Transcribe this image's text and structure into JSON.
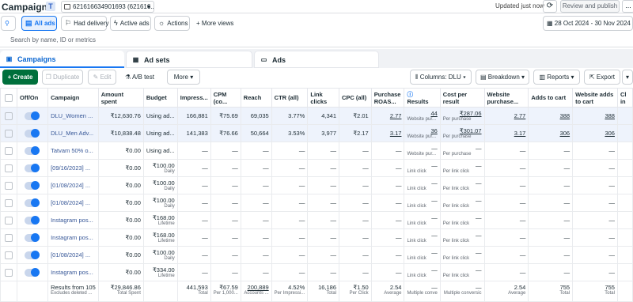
{
  "header": {
    "title": "Campaigns",
    "account_badge": "T",
    "account_label": "621616634901693 (621616...",
    "updated": "Updated just now",
    "review_label": "Review and publish",
    "more_label": "..."
  },
  "filters": {
    "all_ads": "All ads",
    "had_delivery": "Had delivery",
    "active_ads": "Active ads",
    "actions": "Actions",
    "more_views": "More views",
    "date_range": "28 Oct 2024 - 30 Nov 2024"
  },
  "search": {
    "placeholder": "Search by name, ID or metrics"
  },
  "tabs": {
    "campaigns": "Campaigns",
    "adsets": "Ad sets",
    "ads": "Ads"
  },
  "toolbar": {
    "create": "Create",
    "duplicate": "Duplicate",
    "edit": "Edit",
    "abtest": "A/B test",
    "more": "More",
    "columns": "Columns: DLU",
    "breakdown": "Breakdown",
    "reports": "Reports",
    "export": "Export"
  },
  "columns": {
    "onoff": "Off/On",
    "campaign": "Campaign",
    "amount": "Amount spent",
    "budget": "Budget",
    "impressions": "Impress...",
    "cpm": "CPM (co...",
    "reach": "Reach",
    "ctr": "CTR (all)",
    "link_clicks": "Link clicks",
    "cpc": "CPC (all)",
    "roas": "Purchase ROAS...",
    "results": "Results",
    "cost_per_result": "Cost per result",
    "website_purchase": "Website purchase...",
    "adds_to_cart": "Adds to cart",
    "website_adds": "Website adds to cart",
    "last_partial": "Cl in"
  },
  "rows": [
    {
      "selected": true,
      "campaign": "DLU_Women ...",
      "amount": "₹12,630.76",
      "budget": "Using ad...",
      "budget_sub": "",
      "impressions": "166,881",
      "cpm": "₹75.69",
      "reach": "69,035",
      "ctr": "3.77%",
      "link_clicks": "4,341",
      "cpc": "₹2.01",
      "roas": "2.77",
      "results": "44",
      "results_sub": "Website pur...",
      "cost": "₹287.06",
      "cost_sub": "Per purchase",
      "wp": "2.77",
      "atc": "388",
      "wa": "388"
    },
    {
      "selected": true,
      "campaign": "DLU_Men Adv...",
      "amount": "₹10,838.48",
      "budget": "Using ad...",
      "budget_sub": "",
      "impressions": "141,383",
      "cpm": "₹76.66",
      "reach": "50,664",
      "ctr": "3.53%",
      "link_clicks": "3,977",
      "cpc": "₹2.17",
      "roas": "3.17",
      "results": "36",
      "results_sub": "Website pur...",
      "cost": "₹301.07",
      "cost_sub": "Per purchase",
      "wp": "3.17",
      "atc": "306",
      "wa": "306"
    },
    {
      "selected": false,
      "campaign": "Tatvam 50% o...",
      "amount": "₹0.00",
      "budget": "Using ad...",
      "budget_sub": "",
      "impressions": "—",
      "cpm": "—",
      "reach": "—",
      "ctr": "—",
      "link_clicks": "—",
      "cpc": "—",
      "roas": "—",
      "results": "—",
      "results_sub": "Website pur...",
      "cost": "—",
      "cost_sub": "Per purchase",
      "wp": "—",
      "atc": "—",
      "wa": "—"
    },
    {
      "selected": false,
      "campaign": "[09/16/2023] ...",
      "amount": "₹0.00",
      "budget": "₹100.00",
      "budget_sub": "Daily",
      "impressions": "—",
      "cpm": "—",
      "reach": "—",
      "ctr": "—",
      "link_clicks": "—",
      "cpc": "—",
      "roas": "—",
      "results": "—",
      "results_sub": "Link click",
      "cost": "—",
      "cost_sub": "Per link click",
      "wp": "—",
      "atc": "—",
      "wa": "—"
    },
    {
      "selected": false,
      "campaign": "[01/08/2024] ...",
      "amount": "₹0.00",
      "budget": "₹100.00",
      "budget_sub": "Daily",
      "impressions": "—",
      "cpm": "—",
      "reach": "—",
      "ctr": "—",
      "link_clicks": "—",
      "cpc": "—",
      "roas": "—",
      "results": "—",
      "results_sub": "Link click",
      "cost": "—",
      "cost_sub": "Per link click",
      "wp": "—",
      "atc": "—",
      "wa": "—"
    },
    {
      "selected": false,
      "campaign": "[01/08/2024] ...",
      "amount": "₹0.00",
      "budget": "₹100.00",
      "budget_sub": "Daily",
      "impressions": "—",
      "cpm": "—",
      "reach": "—",
      "ctr": "—",
      "link_clicks": "—",
      "cpc": "—",
      "roas": "—",
      "results": "—",
      "results_sub": "Link click",
      "cost": "—",
      "cost_sub": "Per link click",
      "wp": "—",
      "atc": "—",
      "wa": "—"
    },
    {
      "selected": false,
      "campaign": "Instagram pos...",
      "amount": "₹0.00",
      "budget": "₹168.00",
      "budget_sub": "Lifetime",
      "impressions": "—",
      "cpm": "—",
      "reach": "—",
      "ctr": "—",
      "link_clicks": "—",
      "cpc": "—",
      "roas": "—",
      "results": "—",
      "results_sub": "Link click",
      "cost": "—",
      "cost_sub": "Per link click",
      "wp": "—",
      "atc": "—",
      "wa": "—"
    },
    {
      "selected": false,
      "campaign": "Instagram pos...",
      "amount": "₹0.00",
      "budget": "₹168.00",
      "budget_sub": "Lifetime",
      "impressions": "—",
      "cpm": "—",
      "reach": "—",
      "ctr": "—",
      "link_clicks": "—",
      "cpc": "—",
      "roas": "—",
      "results": "—",
      "results_sub": "Link click",
      "cost": "—",
      "cost_sub": "Per link click",
      "wp": "—",
      "atc": "—",
      "wa": "—"
    },
    {
      "selected": false,
      "campaign": "[01/08/2024] ...",
      "amount": "₹0.00",
      "budget": "₹100.00",
      "budget_sub": "Daily",
      "impressions": "—",
      "cpm": "—",
      "reach": "—",
      "ctr": "—",
      "link_clicks": "—",
      "cpc": "—",
      "roas": "—",
      "results": "—",
      "results_sub": "Link click",
      "cost": "—",
      "cost_sub": "Per link click",
      "wp": "—",
      "atc": "—",
      "wa": "—"
    },
    {
      "selected": false,
      "campaign": "Instagram pos...",
      "amount": "₹0.00",
      "budget": "₹334.00",
      "budget_sub": "Lifetime",
      "impressions": "—",
      "cpm": "—",
      "reach": "—",
      "ctr": "—",
      "link_clicks": "—",
      "cpc": "—",
      "roas": "—",
      "results": "—",
      "results_sub": "Link click",
      "cost": "—",
      "cost_sub": "Per link click",
      "wp": "—",
      "atc": "—",
      "wa": "—"
    }
  ],
  "totals": {
    "campaign": "Results from 105",
    "campaign_sub": "Excludes deleted ...",
    "amount": "₹29,846.86",
    "amount_sub": "Total Spent",
    "impressions": "441,593",
    "impressions_sub": "Total",
    "cpm": "₹67.59",
    "cpm_sub": "Per 1,000...",
    "reach": "200,889",
    "reach_sub": "Accounts ...",
    "ctr": "4.52%",
    "ctr_sub": "Per Impressi...",
    "link_clicks": "16,186",
    "link_clicks_sub": "Total",
    "cpc": "₹1.50",
    "cpc_sub": "Per Click",
    "roas": "2.54",
    "roas_sub": "Average",
    "results": "—",
    "results_sub": "Multiple conve",
    "cost": "—",
    "cost_sub": "Multiple conversic",
    "wp": "2.54",
    "wp_sub": "Average",
    "atc": "755",
    "atc_sub": "Total",
    "wa": "755",
    "wa_sub": "Total"
  }
}
